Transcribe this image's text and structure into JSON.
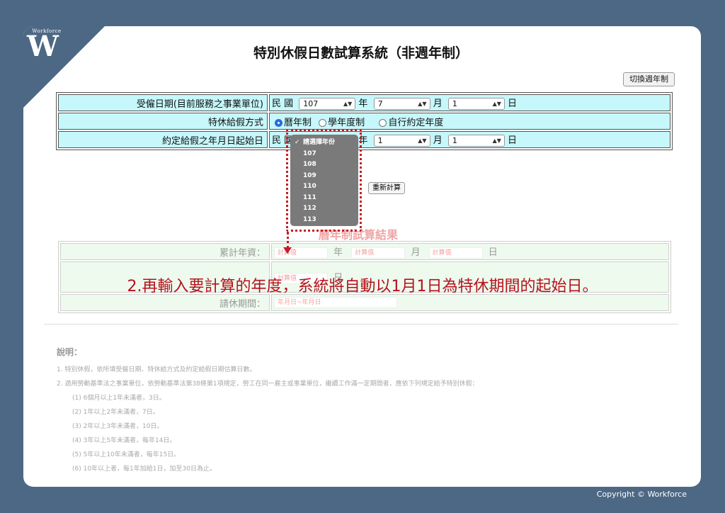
{
  "brand": {
    "small": "Workforce",
    "letter": "W"
  },
  "title": "特別休假日數試算系統（非週年制）",
  "toggle_button": "切換週年制",
  "form": {
    "hire_date": {
      "label": "受僱日期(目前服務之事業單位)",
      "prefix": "民 國",
      "year": "107",
      "year_unit": "年",
      "month": "7",
      "month_unit": "月",
      "day": "1",
      "day_unit": "日"
    },
    "method": {
      "label": "特休給假方式",
      "options": [
        "曆年制",
        "學年度制",
        "自行約定年度"
      ],
      "selected": "曆年制"
    },
    "start_date": {
      "label": "約定給假之年月日起始日",
      "prefix": "民 國",
      "year_unit": "年",
      "month": "1",
      "month_unit": "月",
      "day": "1",
      "day_unit": "日"
    }
  },
  "recalc_button": "重新計算",
  "dropdown": {
    "options": [
      "請選擇年份",
      "107",
      "108",
      "109",
      "110",
      "111",
      "112",
      "113"
    ],
    "checked": "請選擇年份"
  },
  "result": {
    "title": "曆年制試算結果",
    "rows": [
      {
        "label": "累計年資：",
        "placeholders": [
          "計算值",
          "計算值",
          "計算值"
        ],
        "units": [
          "年",
          "月",
          "日"
        ]
      },
      {
        "label": "",
        "placeholders": [
          "計算值"
        ],
        "units": [
          "日"
        ]
      },
      {
        "label": "請休期間：",
        "placeholders": [
          "年月日~年月日"
        ],
        "units": []
      }
    ]
  },
  "caption": "2.再輸入要計算的年度，系統將自動以1月1日為特休期間的起始日。",
  "notes": {
    "heading": "說明：",
    "items": [
      "1. 特別休假，依所填受僱日期、特休給方式及約定給假日期估算日數。",
      "2. 適用勞動基準法之事業單位，依勞動基準法第38條第1項規定，勞工在同一雇主或事業單位，繼續工作滿一定期間者，應依下列規定給予特別休假："
    ],
    "sub_items": [
      "(1) 6個月以上1年未滿者，3日。",
      "(2) 1年以上2年未滿者，7日。",
      "(3) 2年以上3年未滿者，10日。",
      "(4) 3年以上5年未滿者，每年14日。",
      "(5) 5年以上10年未滿者，每年15日。",
      "(6) 10年以上者，每1年加給1日，加至30日為止。"
    ]
  },
  "copyright": "Copyright © Workforce",
  "colors": {
    "background": "#4d6884",
    "form_row": "#c6f7fb",
    "result_row": "#eefaee",
    "caption": "#b5121b",
    "annotation": "#c31d24"
  }
}
